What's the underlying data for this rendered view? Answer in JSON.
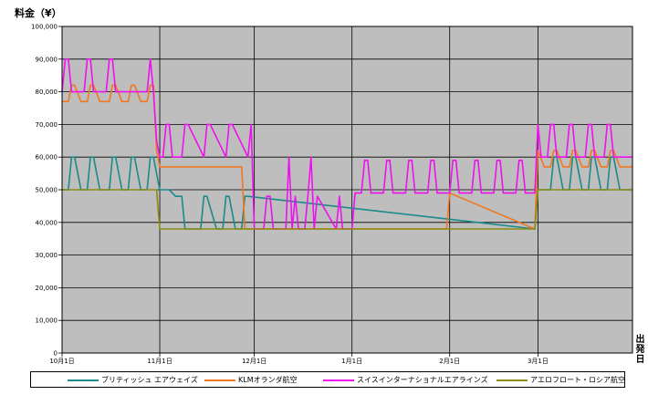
{
  "chart_data": {
    "type": "line",
    "ylabel": "料金（¥）",
    "xlabel": "出発日",
    "ylim": [
      0,
      100000
    ],
    "yticks": [
      "0",
      "10,000",
      "20,000",
      "30,000",
      "40,000",
      "50,000",
      "60,000",
      "70,000",
      "80,000",
      "90,000",
      "100,000"
    ],
    "xticks": [
      "10月1日",
      "11月1日",
      "12月1日",
      "1月1日",
      "2月1日",
      "3月1日"
    ],
    "x_start": "2008-10-01",
    "x_end": "2009-03-31",
    "grid": true,
    "legend_position": "bottom",
    "plot_background": "#bebebe",
    "series": [
      {
        "name": "ブリティッシュ エアウェイズ",
        "color": "#1a8a8a",
        "x": [
          "2008-10-01",
          "2008-10-03",
          "2008-10-04",
          "2008-10-05",
          "2008-10-07",
          "2008-10-09",
          "2008-10-10",
          "2008-10-11",
          "2008-10-13",
          "2008-10-16",
          "2008-10-17",
          "2008-10-18",
          "2008-10-20",
          "2008-10-22",
          "2008-10-23",
          "2008-10-24",
          "2008-10-26",
          "2008-10-28",
          "2008-10-29",
          "2008-10-30",
          "2008-11-01",
          "2008-11-02",
          "2008-11-04",
          "2008-11-06",
          "2008-11-08",
          "2008-11-09",
          "2008-11-10",
          "2008-11-14",
          "2008-11-15",
          "2008-11-16",
          "2008-11-19",
          "2008-11-21",
          "2008-11-22",
          "2008-11-23",
          "2008-11-25",
          "2008-11-27",
          "2008-11-28",
          "2008-11-29",
          "2009-02-28",
          "2009-03-01",
          "2009-03-03",
          "2009-03-05",
          "2009-03-06",
          "2009-03-07",
          "2009-03-09",
          "2009-03-11",
          "2009-03-12",
          "2009-03-13",
          "2009-03-15",
          "2009-03-17",
          "2009-03-18",
          "2009-03-19",
          "2009-03-21",
          "2009-03-23",
          "2009-03-24",
          "2009-03-25",
          "2009-03-27",
          "2009-03-31"
        ],
        "values": [
          50000,
          50000,
          60000,
          60000,
          50000,
          50000,
          60000,
          60000,
          50000,
          50000,
          60000,
          60000,
          50000,
          50000,
          60000,
          60000,
          50000,
          50000,
          60000,
          60000,
          50000,
          50000,
          50000,
          48000,
          48000,
          38000,
          38000,
          38000,
          48000,
          48000,
          38000,
          38000,
          48000,
          48000,
          38000,
          38000,
          48000,
          48000,
          38000,
          50000,
          50000,
          50000,
          60000,
          60000,
          50000,
          50000,
          60000,
          60000,
          50000,
          50000,
          60000,
          60000,
          50000,
          50000,
          60000,
          60000,
          50000,
          50000
        ]
      },
      {
        "name": "KLMオランダ航空",
        "color": "#f07820",
        "x": [
          "2008-10-01",
          "2008-10-03",
          "2008-10-04",
          "2008-10-05",
          "2008-10-07",
          "2008-10-09",
          "2008-10-10",
          "2008-10-11",
          "2008-10-13",
          "2008-10-16",
          "2008-10-17",
          "2008-10-18",
          "2008-10-20",
          "2008-10-22",
          "2008-10-23",
          "2008-10-24",
          "2008-10-26",
          "2008-10-28",
          "2008-10-29",
          "2008-10-30",
          "2008-10-31",
          "2008-11-01",
          "2008-11-02",
          "2008-11-27",
          "2008-11-28",
          "2009-01-31",
          "2009-02-01",
          "2009-02-28",
          "2009-03-01",
          "2009-03-03",
          "2009-03-05",
          "2009-03-06",
          "2009-03-07",
          "2009-03-09",
          "2009-03-11",
          "2009-03-12",
          "2009-03-13",
          "2009-03-15",
          "2009-03-17",
          "2009-03-18",
          "2009-03-19",
          "2009-03-21",
          "2009-03-23",
          "2009-03-24",
          "2009-03-25",
          "2009-03-27",
          "2009-03-31"
        ],
        "values": [
          77000,
          77000,
          82000,
          82000,
          77000,
          77000,
          82000,
          82000,
          77000,
          77000,
          82000,
          82000,
          77000,
          77000,
          82000,
          82000,
          77000,
          77000,
          82000,
          82000,
          62000,
          57000,
          57000,
          57000,
          38000,
          38000,
          49000,
          38000,
          62000,
          57000,
          57000,
          62000,
          62000,
          57000,
          57000,
          62000,
          62000,
          57000,
          57000,
          62000,
          62000,
          57000,
          57000,
          62000,
          62000,
          57000,
          57000
        ]
      },
      {
        "name": "スイスインターナショナルエアラインズ",
        "color": "#ee11ee",
        "x": [
          "2008-10-01",
          "2008-10-02",
          "2008-10-03",
          "2008-10-04",
          "2008-10-05",
          "2008-10-08",
          "2008-10-09",
          "2008-10-10",
          "2008-10-11",
          "2008-10-12",
          "2008-10-15",
          "2008-10-16",
          "2008-10-17",
          "2008-10-18",
          "2008-10-19",
          "2008-10-28",
          "2008-10-29",
          "2008-10-30",
          "2008-10-31",
          "2008-11-01",
          "2008-11-02",
          "2008-11-03",
          "2008-11-04",
          "2008-11-05",
          "2008-11-08",
          "2008-11-09",
          "2008-11-10",
          "2008-11-15",
          "2008-11-16",
          "2008-11-17",
          "2008-11-22",
          "2008-11-23",
          "2008-11-24",
          "2008-11-29",
          "2008-11-30",
          "2008-12-01",
          "2008-12-04",
          "2008-12-05",
          "2008-12-06",
          "2008-12-07",
          "2008-12-11",
          "2008-12-12",
          "2008-12-13",
          "2008-12-14",
          "2008-12-15",
          "2008-12-17",
          "2008-12-18",
          "2008-12-19",
          "2008-12-20",
          "2008-12-21",
          "2008-12-27",
          "2008-12-28",
          "2008-12-29",
          "2009-01-01",
          "2009-01-02",
          "2009-01-04",
          "2009-01-05",
          "2009-01-06",
          "2009-01-07",
          "2009-01-11",
          "2009-01-12",
          "2009-01-13",
          "2009-01-14",
          "2009-01-18",
          "2009-01-19",
          "2009-01-20",
          "2009-01-21",
          "2009-01-25",
          "2009-01-26",
          "2009-01-27",
          "2009-01-28",
          "2009-02-01",
          "2009-02-02",
          "2009-02-03",
          "2009-02-04",
          "2009-02-08",
          "2009-02-09",
          "2009-02-10",
          "2009-02-11",
          "2009-02-15",
          "2009-02-16",
          "2009-02-17",
          "2009-02-18",
          "2009-02-22",
          "2009-02-23",
          "2009-02-24",
          "2009-02-25",
          "2009-02-28",
          "2009-03-01",
          "2009-03-02",
          "2009-03-04",
          "2009-03-05",
          "2009-03-06",
          "2009-03-07",
          "2009-03-08",
          "2009-03-10",
          "2009-03-11",
          "2009-03-12",
          "2009-03-13",
          "2009-03-14",
          "2009-03-16",
          "2009-03-17",
          "2009-03-18",
          "2009-03-19",
          "2009-03-20",
          "2009-03-22",
          "2009-03-23",
          "2009-03-24",
          "2009-03-25",
          "2009-03-26",
          "2009-03-28",
          "2009-03-31"
        ],
        "values": [
          80000,
          90000,
          90000,
          80000,
          80000,
          80000,
          90000,
          90000,
          80000,
          80000,
          80000,
          90000,
          90000,
          80000,
          80000,
          80000,
          90000,
          80000,
          65000,
          60000,
          60000,
          70000,
          70000,
          60000,
          60000,
          70000,
          70000,
          60000,
          70000,
          70000,
          60000,
          70000,
          70000,
          60000,
          70000,
          38000,
          38000,
          48000,
          48000,
          38000,
          38000,
          60000,
          38000,
          48000,
          38000,
          38000,
          48000,
          60000,
          38000,
          48000,
          38000,
          48000,
          38000,
          38000,
          49000,
          49000,
          59000,
          59000,
          49000,
          49000,
          59000,
          59000,
          49000,
          49000,
          59000,
          59000,
          49000,
          49000,
          59000,
          59000,
          49000,
          49000,
          59000,
          59000,
          49000,
          49000,
          59000,
          59000,
          49000,
          49000,
          59000,
          59000,
          49000,
          49000,
          59000,
          59000,
          49000,
          49000,
          70000,
          60000,
          60000,
          70000,
          70000,
          60000,
          60000,
          60000,
          70000,
          70000,
          60000,
          60000,
          60000,
          70000,
          70000,
          60000,
          60000,
          60000,
          70000,
          70000,
          60000,
          60000,
          60000,
          60000
        ]
      },
      {
        "name": "アエロフロート・ロシア航空",
        "color": "#8c8c10",
        "x": [
          "2008-10-01",
          "2008-10-30",
          "2008-10-31",
          "2008-11-01",
          "2009-02-28",
          "2009-03-01",
          "2009-03-31"
        ],
        "values": [
          50000,
          50000,
          50000,
          38000,
          38000,
          50000,
          50000
        ]
      }
    ]
  }
}
